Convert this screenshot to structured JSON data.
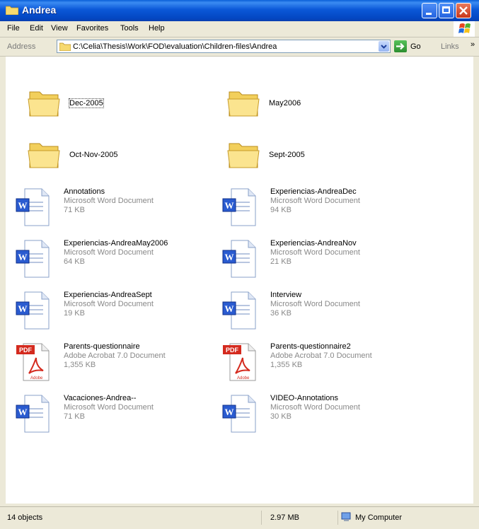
{
  "window": {
    "title": "Andrea"
  },
  "menu": [
    "File",
    "Edit",
    "View",
    "Favorites",
    "Tools",
    "Help"
  ],
  "address": {
    "label": "Address",
    "path": "C:\\Celia\\Thesis\\Work\\FOD\\evaluation\\Children-files\\Andrea",
    "go_label": "Go",
    "links_label": "Links",
    "links_chevron": "»"
  },
  "folders": [
    {
      "name": "Dec-2005"
    },
    {
      "name": "May2006"
    },
    {
      "name": "Oct-Nov-2005"
    },
    {
      "name": "Sept-2005"
    }
  ],
  "files": [
    {
      "name": "Annotations",
      "type": "Microsoft Word Document",
      "size": "71 KB",
      "icon": "word-doc-icon"
    },
    {
      "name": "Experiencias-AndreaDec",
      "type": "Microsoft Word Document",
      "size": "94 KB",
      "icon": "word-doc-icon"
    },
    {
      "name": "Experiencias-AndreaMay2006",
      "type": "Microsoft Word Document",
      "size": "64 KB",
      "icon": "word-doc-icon"
    },
    {
      "name": "Experiencias-AndreaNov",
      "type": "Microsoft Word Document",
      "size": "21 KB",
      "icon": "word-doc-icon"
    },
    {
      "name": "Experiencias-AndreaSept",
      "type": "Microsoft Word Document",
      "size": "19 KB",
      "icon": "word-doc-icon"
    },
    {
      "name": "Interview",
      "type": "Microsoft Word Document",
      "size": "36 KB",
      "icon": "word-doc-icon"
    },
    {
      "name": "Parents-questionnaire",
      "type": "Adobe Acrobat 7.0 Document",
      "size": "1,355 KB",
      "icon": "pdf-doc-icon"
    },
    {
      "name": "Parents-questionnaire2",
      "type": "Adobe Acrobat 7.0 Document",
      "size": "1,355 KB",
      "icon": "pdf-doc-icon"
    },
    {
      "name": "Vacaciones-Andrea--",
      "type": "Microsoft Word Document",
      "size": "71 KB",
      "icon": "word-doc-icon"
    },
    {
      "name": "VIDEO-Annotations",
      "type": "Microsoft Word Document",
      "size": "30 KB",
      "icon": "word-doc-icon"
    }
  ],
  "pdf_badge": "PDF",
  "pdf_brand": "Adobe",
  "status": {
    "objects": "14 objects",
    "size": "2.97 MB",
    "location": "My Computer"
  },
  "colors": {
    "titlebar": "#0b58d8",
    "window_bg": "#ece9d8",
    "folder": "#f5d76e",
    "pdf_red": "#d42a1e",
    "word_blue": "#2a5bd0"
  }
}
